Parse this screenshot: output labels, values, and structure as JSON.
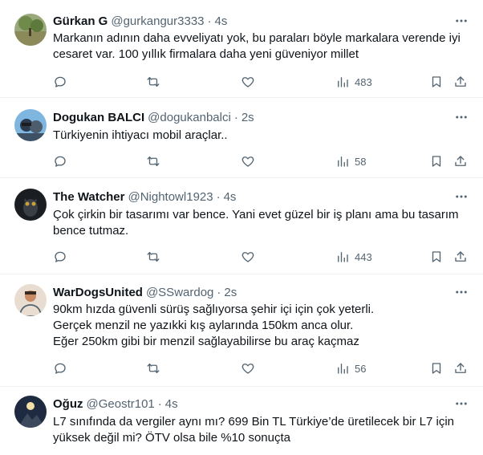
{
  "tweets": [
    {
      "name": "Gürkan G",
      "handle": "@gurkangur3333",
      "separator": "·",
      "time": "4s",
      "lines": [
        "Markanın adının daha evveliyatı yok, bu paraları böyle markalara verende iyi",
        "cesaret var. 100 yıllık firmalara daha yeni güveniyor millet"
      ],
      "views": "483"
    },
    {
      "name": "Dogukan BALCI",
      "handle": "@dogukanbalci",
      "separator": "·",
      "time": "2s",
      "lines": [
        "Türkiyenin ihtiyacı mobil araçlar.."
      ],
      "views": "58"
    },
    {
      "name": "The Watcher",
      "handle": "@Nightowl1923",
      "separator": "·",
      "time": "4s",
      "lines": [
        "Çok çirkin bir tasarımı var bence. Yani evet güzel bir iş planı ama bu tasarım",
        "bence tutmaz."
      ],
      "views": "443"
    },
    {
      "name": "WarDogsUnited",
      "handle": "@SSwardog",
      "separator": "·",
      "time": "2s",
      "lines": [
        "90km hızda güvenli sürüş sağlıyorsa şehir içi için çok yeterli.",
        "Gerçek menzil ne yazıkki kış aylarında 150km anca olur.",
        "Eğer 250km gibi bir menzil sağlayabilirse bu araç kaçmaz"
      ],
      "views": "56"
    },
    {
      "name": "Oğuz",
      "handle": "@Geostr101",
      "separator": "·",
      "time": "4s",
      "lines": [
        "L7 sınıfında da vergiler aynı mı? 699 Bin TL Türkiye’de üretilecek bir L7 için",
        "yüksek değil mi? ÖTV olsa bile %10 sonuçta"
      ],
      "views": ""
    }
  ],
  "icons": {
    "reply": "reply-icon",
    "retweet": "retweet-icon",
    "like": "like-icon",
    "views": "views-icon",
    "bookmark": "bookmark-icon",
    "share": "share-icon",
    "more": "more-icon"
  },
  "colors": {
    "text": "#0f1419",
    "secondary": "#536471",
    "divider": "#eff3f4"
  }
}
